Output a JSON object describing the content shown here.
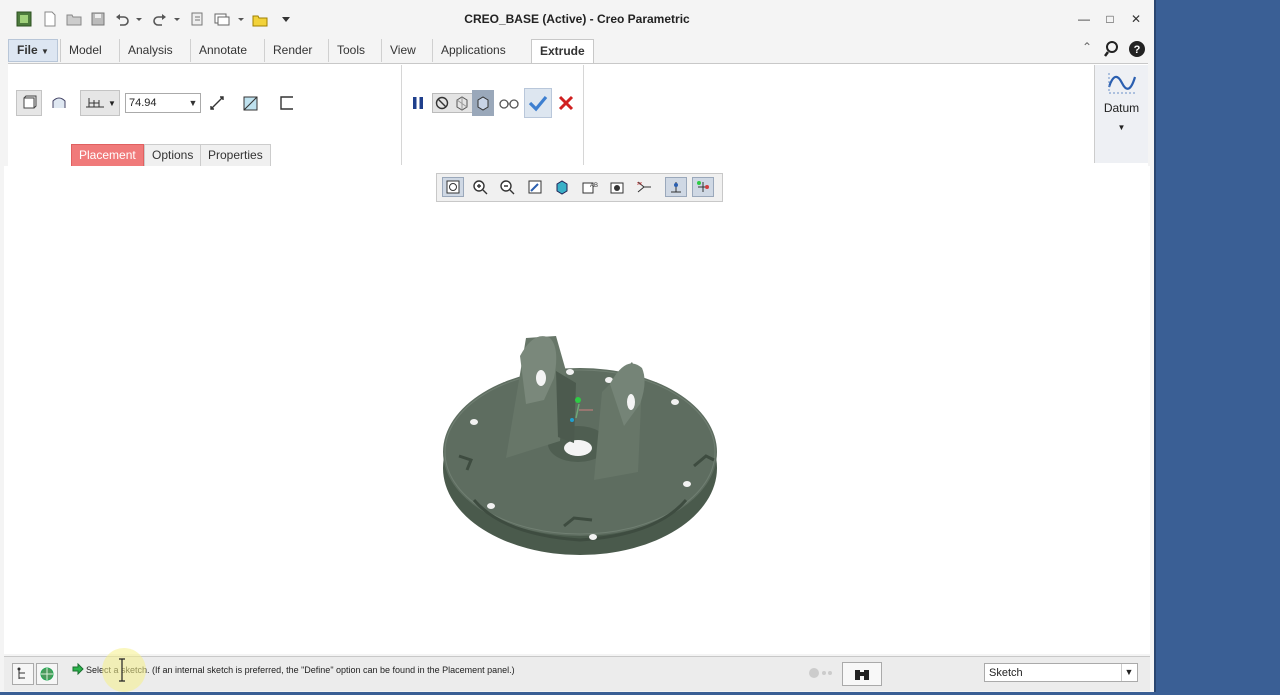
{
  "window": {
    "title": "CREO_BASE (Active) - Creo Parametric"
  },
  "ribbon_tabs": [
    {
      "label": "File"
    },
    {
      "label": "Model"
    },
    {
      "label": "Analysis"
    },
    {
      "label": "Annotate"
    },
    {
      "label": "Render"
    },
    {
      "label": "Tools"
    },
    {
      "label": "View"
    },
    {
      "label": "Applications"
    },
    {
      "label": "Extrude"
    }
  ],
  "extrude": {
    "depth_value": "74.94",
    "subtabs": [
      {
        "label": "Placement"
      },
      {
        "label": "Options"
      },
      {
        "label": "Properties"
      }
    ]
  },
  "datum": {
    "label": "Datum"
  },
  "status": {
    "message": "Select a sketch. (If an internal sketch is preferred, the \"Define\" option can be found in the Placement panel.)",
    "filter_value": "Sketch"
  },
  "colors": {
    "model": "#5e6d60",
    "active_subtab": "#f07a7a",
    "accept": "#3d7fd0",
    "cancel": "#d02020"
  }
}
